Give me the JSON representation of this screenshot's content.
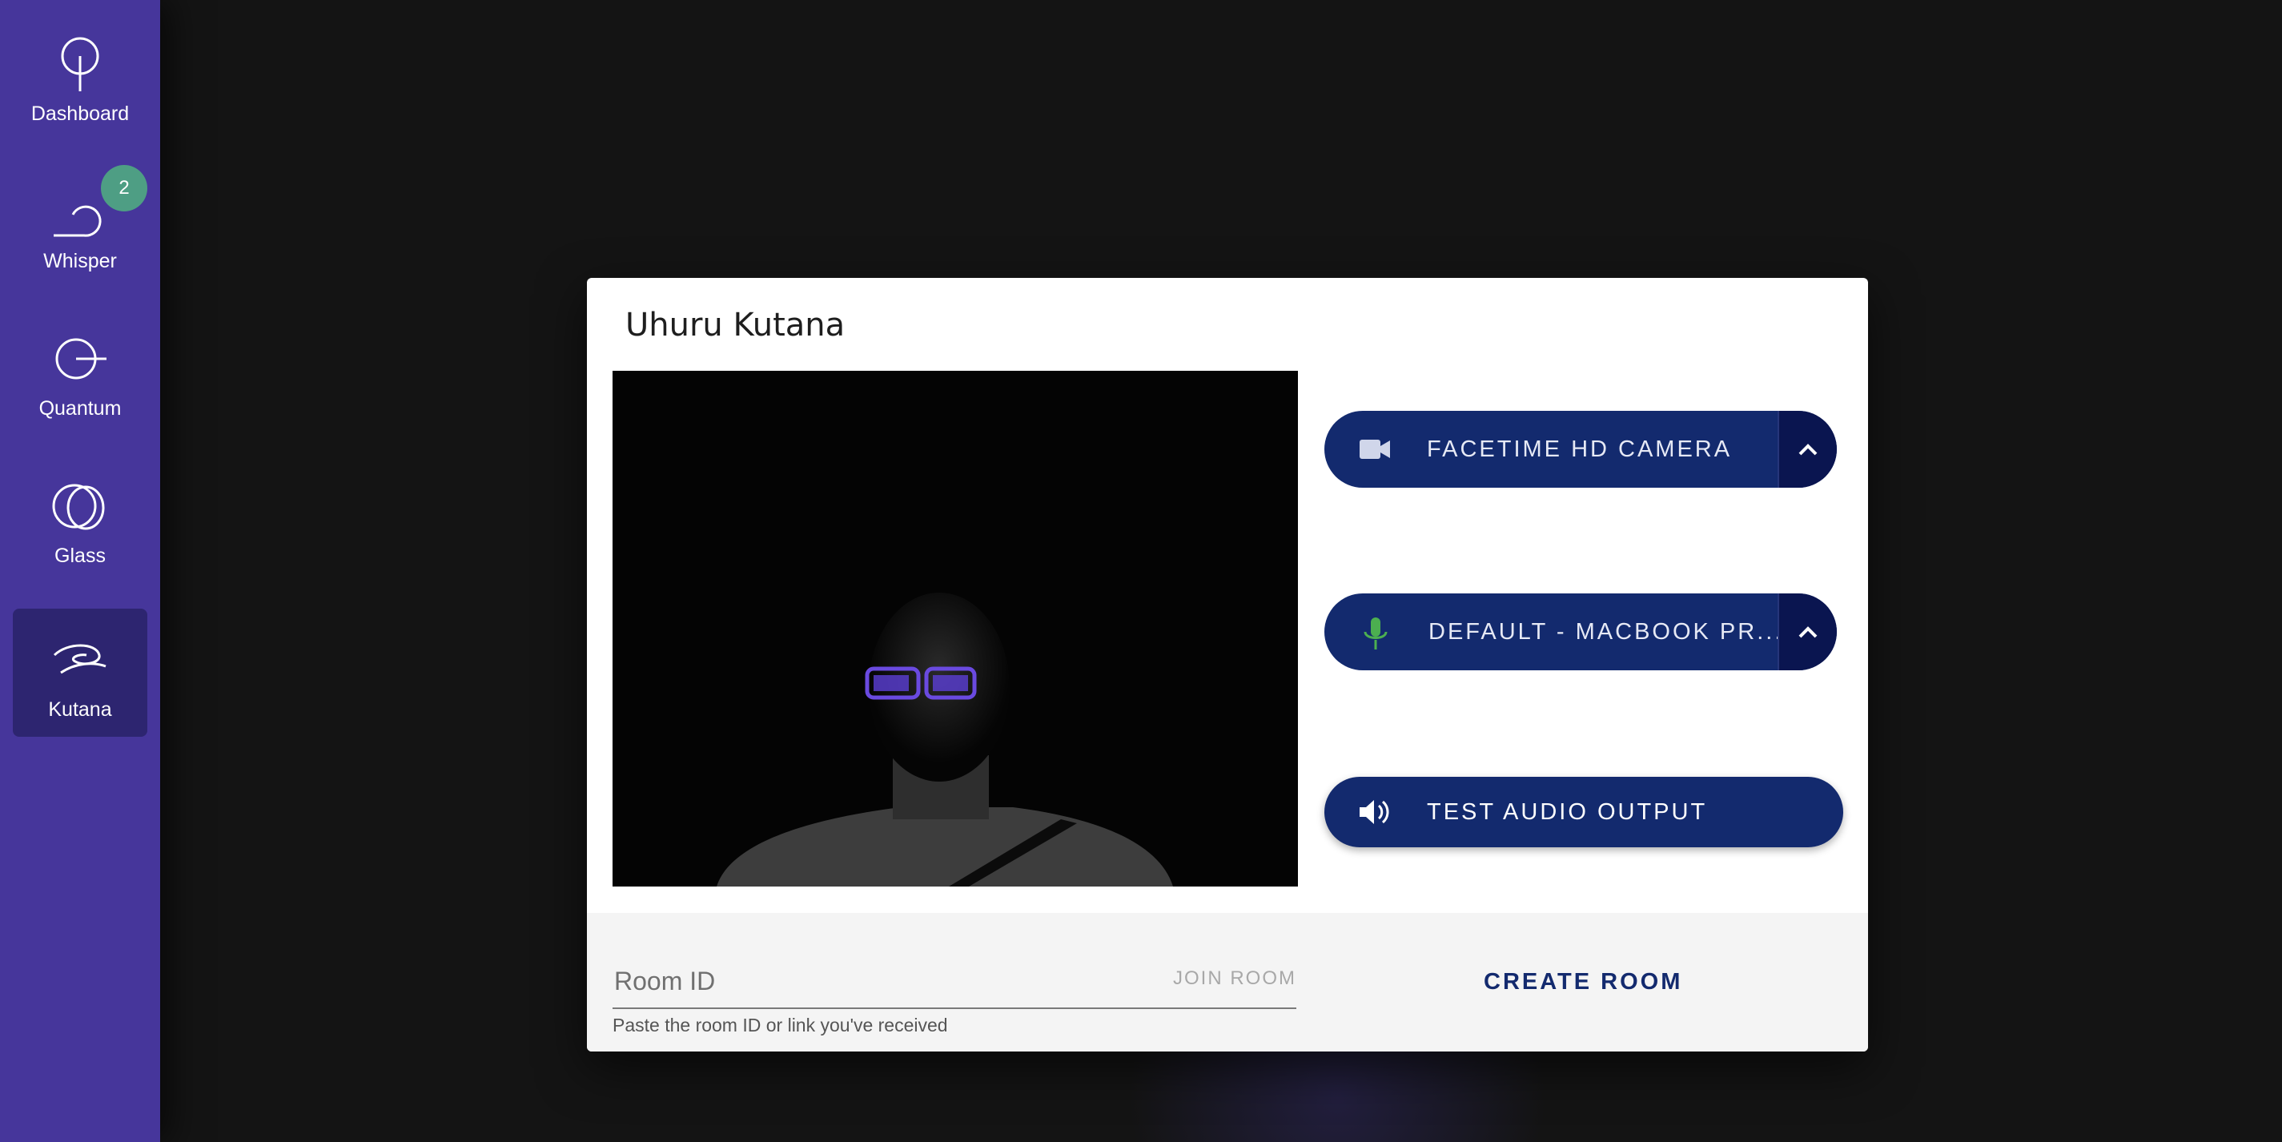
{
  "sidebar": {
    "items": [
      {
        "label": "Dashboard",
        "icon": "dashboard-icon"
      },
      {
        "label": "Whisper",
        "icon": "whisper-icon",
        "badge": "2"
      },
      {
        "label": "Quantum",
        "icon": "quantum-icon"
      },
      {
        "label": "Glass",
        "icon": "glass-icon"
      },
      {
        "label": "Kutana",
        "icon": "kutana-icon",
        "active": true
      }
    ]
  },
  "dialog": {
    "title": "Uhuru Kutana",
    "camera_label": "FACETIME HD CAMERA",
    "mic_label": "DEFAULT - MACBOOK PR...",
    "audio_test_label": "TEST AUDIO OUTPUT",
    "room_input_placeholder": "Room ID",
    "join_label": "JOIN ROOM",
    "helper_text": "Paste the room ID or link you've received",
    "create_label": "CREATE ROOM"
  },
  "colors": {
    "sidebar": "#46369b",
    "sidebar_active": "#2d2570",
    "badge": "#4e9e84",
    "button": "#132a6e",
    "button_chevron": "#0a1550",
    "mic_icon": "#4caf50"
  }
}
